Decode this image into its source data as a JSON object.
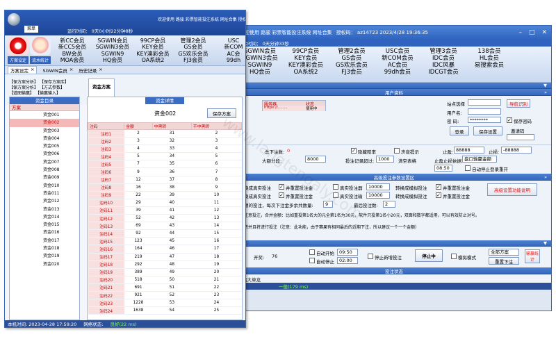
{
  "back": {
    "title": "欢迎使用 路骏 彩票智能投注系统 网址合集",
    "auth": "授权码： az14723  2023/4/28 19:36:35",
    "sub": "剩余时间： 0天分钟33秒",
    "tiles": [
      [
        "SGWIN会员",
        "SGWIN3会员",
        "SGWIN9",
        "HQ会员"
      ],
      [
        "99CP会员",
        "KEY会员",
        "KEY澳彩会员",
        "OA系统2"
      ],
      [
        "管理2会员",
        "GS会员",
        "GS欢乐会员",
        "FJ3会员"
      ],
      [
        "USC会员",
        "新COM会员",
        "AC会员",
        "99dh会员"
      ],
      [
        "管理3会员",
        "IDC会员",
        "IDC风暴",
        "IDCGT会员"
      ],
      [
        "138会员",
        "HL会员",
        "易搜索会员"
      ]
    ],
    "user_band": "用户资料",
    "server_col": "服务器",
    "status_col": "状态",
    "server_val": "https://........",
    "status_val": "使用中",
    "site_label": "站点选择",
    "user_label": "用户名:",
    "pwd_label": "密   码:",
    "pwd_val": "********",
    "nav_btn": "导航识别",
    "save_pwd": "保存密码",
    "login": "登录",
    "save_settings": "保存设置",
    "invite": "邀请码",
    "total_bets": "总下注数:",
    "total_bets_val": "0",
    "hide_pan": "隐藏赔率",
    "sound": "声音提示",
    "stop_win": "止盈:",
    "stop_win_val": "88888",
    "stop_loss": "止损:",
    "stop_loss_val": "-88888",
    "seg_label": "大额分段:",
    "seg_val": "8000",
    "rec_label": "投注记录超过:",
    "rec_val": "1000",
    "clear": "清空表格",
    "stop_base": "止盈止损依据:",
    "stop_base_val": "盘口输赢金额",
    "time_val": "08:50",
    "auto_relogin": "自动停止登录重开",
    "adv_band": "高级投注参数设置区",
    "adv_l1": "换成真实投注",
    "adv_l2": "并重置投注金",
    "adv_l3": "真实投注器",
    "adv_l4": "转换成模拟投注",
    "adv_l5": "并重置投注金",
    "adv_val": "10000",
    "adv_help": "高级设置功能说明",
    "adv_r2a": "换成真实投注",
    "adv_r2b": "并重置投注金",
    "adv_r2c": "真实投注输",
    "adv_r2d": "转换成模拟投注",
    "adv_r2e": "并重置投注金",
    "adv_r3": "预的投注，每次下注金多余共数量:",
    "adv_r3v": "9",
    "adv_r3b": "最后投注数:",
    "adv_r3bv": "2",
    "adv_r4": "注意投注，合并金额：比如重投第1名大的元全第1名为30元，软件只投第1名小20元，双面和数字都适用，可以有效防止对号。",
    "adv_r5": "进并且将进行投注（注意：此功能，由于赛果有相同最后的近期下注，所以建议一个一个金额）",
    "open_lbl": "开奖:",
    "open_val": "76",
    "auto_start": "自动开始",
    "auto_start_t": "09:50",
    "auto_stop": "自动停止",
    "auto_stop_t": "02:00",
    "stop_new": "停止新增投注",
    "stop_btn": "停止中",
    "sim": "模拟模式",
    "all_plans": "全部方案",
    "reset": "重置下注",
    "stats": "输赢统计",
    "bet_status": "投注状态",
    "bottom": "出大单龙",
    "ping": "一般(179 ms)"
  },
  "front": {
    "menu": "菜单",
    "remain": "运行时间： 0天0小时22分钟8秒",
    "tb_title": "欢迎使用 路骏 彩票智能投注系统 网址合集  授权",
    "rb1": "方案设定",
    "rb2": "流水统计",
    "tiles": [
      [
        "新CC会员",
        "新CC5会员",
        "BW会员",
        "MOA会员"
      ],
      [
        "SGWIN会员",
        "SGWIN3会员",
        "SGWIN9",
        "HQ会员"
      ],
      [
        "99CP会员",
        "KEY会员",
        "KEY澳彩会员",
        "OA系统2"
      ],
      [
        "管理2会员",
        "GS会员",
        "GS欢乐会员",
        "FJ3会员"
      ],
      [
        "USC",
        "新COM",
        "AC会",
        "99dh"
      ]
    ],
    "tabs": [
      "方案设定",
      "SGWIN会员",
      "历史记录"
    ],
    "groups": [
      "【保方案分析】",
      "【保方案分析】",
      "【道图输赢】"
    ],
    "groups2": [
      "【保存方案库】",
      "【方式参数】",
      "【输赢输入】"
    ],
    "plan_tab": "资金方案",
    "list_header": "资金目录",
    "list_col": "方案",
    "list": [
      "资金001",
      "资金002",
      "资金003",
      "资金004",
      "资金005",
      "资金006",
      "资金007",
      "资金008",
      "资金009",
      "资金010",
      "资金011",
      "资金012",
      "资金013",
      "资金014",
      "资金015",
      "资金016",
      "资金017",
      "资金018",
      "资金019",
      "资金020"
    ],
    "detail_header": "资金详情",
    "detail_name": "资金002",
    "save_plan": "保存方案",
    "cols": [
      "注码",
      "金额",
      "中黑转",
      "不中黑转"
    ],
    "rows": [
      [
        "注码1",
        "2",
        "31",
        "2"
      ],
      [
        "注码2",
        "3",
        "32",
        "3"
      ],
      [
        "注码3",
        "4",
        "33",
        "4"
      ],
      [
        "注码4",
        "5",
        "34",
        "5"
      ],
      [
        "注码5",
        "7",
        "35",
        "6"
      ],
      [
        "注码6",
        "9",
        "36",
        "7"
      ],
      [
        "注码7",
        "12",
        "37",
        "8"
      ],
      [
        "注码8",
        "16",
        "38",
        "9"
      ],
      [
        "注码9",
        "22",
        "39",
        "10"
      ],
      [
        "注码10",
        "29",
        "40",
        "11"
      ],
      [
        "注码11",
        "39",
        "41",
        "12"
      ],
      [
        "注码12",
        "52",
        "42",
        "13"
      ],
      [
        "注码13",
        "69",
        "43",
        "14"
      ],
      [
        "注码14",
        "92",
        "44",
        "15"
      ],
      [
        "注码15",
        "123",
        "45",
        "16"
      ],
      [
        "注码16",
        "164",
        "46",
        "17"
      ],
      [
        "注码17",
        "219",
        "47",
        "18"
      ],
      [
        "注码18",
        "292",
        "48",
        "19"
      ],
      [
        "注码19",
        "389",
        "49",
        "20"
      ],
      [
        "注码20",
        "518",
        "50",
        "21"
      ],
      [
        "注码21",
        "691",
        "51",
        "22"
      ],
      [
        "注码22",
        "921",
        "52",
        "23"
      ],
      [
        "注码23",
        "1228",
        "53",
        "24"
      ],
      [
        "注码24",
        "1638",
        "54",
        "25"
      ]
    ],
    "status_time": "本机时间:   2023-04-28 17:59:20",
    "status_net": "网络状态:",
    "status_net_val": "良好(22 ms)"
  },
  "watermark": "www.langtengaly.com"
}
